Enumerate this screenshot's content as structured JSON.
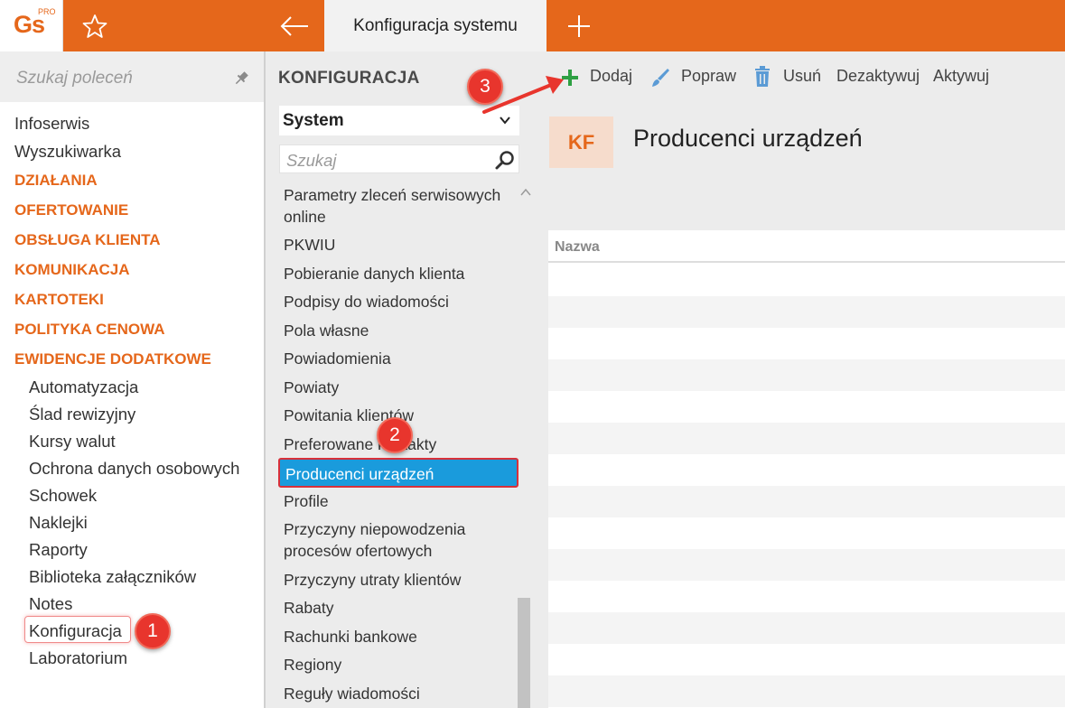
{
  "app": {
    "logo_text": "Gs",
    "logo_badge": "PRO",
    "active_tab": "Konfiguracja systemu"
  },
  "sidebar": {
    "search_placeholder": "Szukaj poleceń",
    "items": [
      "Infoserwis",
      "Wyszukiwarka"
    ],
    "sections": [
      "DZIAŁANIA",
      "OFERTOWANIE",
      "OBSŁUGA KLIENTA",
      "KOMUNIKACJA",
      "KARTOTEKI",
      "POLITYKA CENOWA",
      "EWIDENCJE DODATKOWE"
    ],
    "subitems": [
      "Automatyzacja",
      "Ślad rewizyjny",
      "Kursy walut",
      "Ochrona danych osobowych",
      "Schowek",
      "Naklejki",
      "Raporty",
      "Biblioteka załączników",
      "Notes",
      "Konfiguracja",
      "Laboratorium"
    ]
  },
  "middle": {
    "title": "KONFIGURACJA",
    "select_value": "System",
    "search_placeholder": "Szukaj",
    "items": [
      "Parametry zleceń serwisowych",
      "online",
      "PKWIU",
      "Pobieranie danych klienta",
      "Podpisy do wiadomości",
      "Pola własne",
      "Powiadomienia",
      "Powiaty",
      "Powitania klientów",
      "Preferowane kontakty",
      "Producenci urządzeń",
      "Profile",
      "Przyczyny niepowodzenia",
      "procesów ofertowych",
      "Przyczyny utraty klientów",
      "Rabaty",
      "Rachunki bankowe",
      "Regiony",
      "Reguły wiadomości"
    ]
  },
  "toolbar": {
    "add": "Dodaj",
    "edit": "Popraw",
    "delete": "Usuń",
    "deactivate": "Dezaktywuj",
    "activate": "Aktywuj"
  },
  "content": {
    "badge": "KF",
    "title": "Producenci urządzeń",
    "column": "Nazwa"
  },
  "callouts": [
    "1",
    "2",
    "3"
  ],
  "colors": {
    "accent": "#e5671b",
    "selection": "#1a9bdc",
    "callout": "#e8352d",
    "add_icon": "#2ea043"
  }
}
